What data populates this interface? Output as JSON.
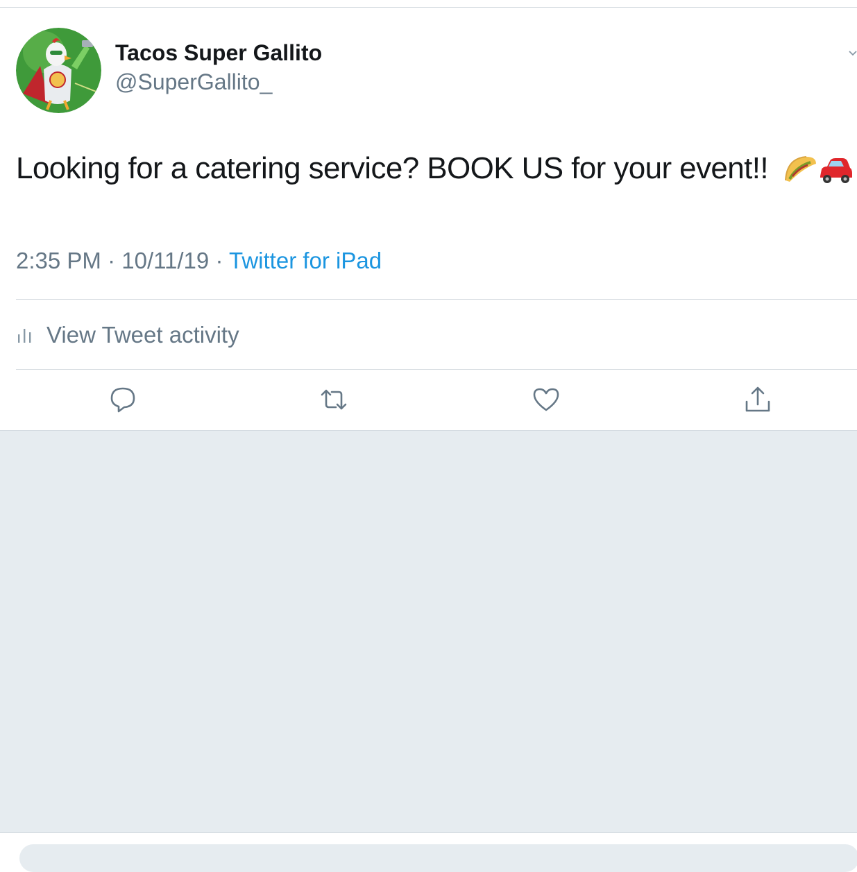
{
  "tweet": {
    "display_name": "Tacos Super Gallito",
    "handle": "@SuperGallito_",
    "text": "Looking for a catering service? BOOK US for your event!!",
    "emojis": [
      "taco-emoji",
      "car-emoji"
    ],
    "time": "2:35 PM",
    "separator": "·",
    "date": "10/11/19",
    "source": "Twitter for iPad"
  },
  "activity": {
    "label": "View Tweet activity",
    "icon": "bar-chart-icon"
  },
  "actions": [
    {
      "name": "reply",
      "icon": "reply-icon"
    },
    {
      "name": "retweet",
      "icon": "retweet-icon"
    },
    {
      "name": "like",
      "icon": "heart-icon"
    },
    {
      "name": "share",
      "icon": "share-icon"
    }
  ],
  "colors": {
    "text": "#14171a",
    "secondary": "#657786",
    "link": "#1b95e0",
    "background_gray": "#e6ecf0"
  }
}
